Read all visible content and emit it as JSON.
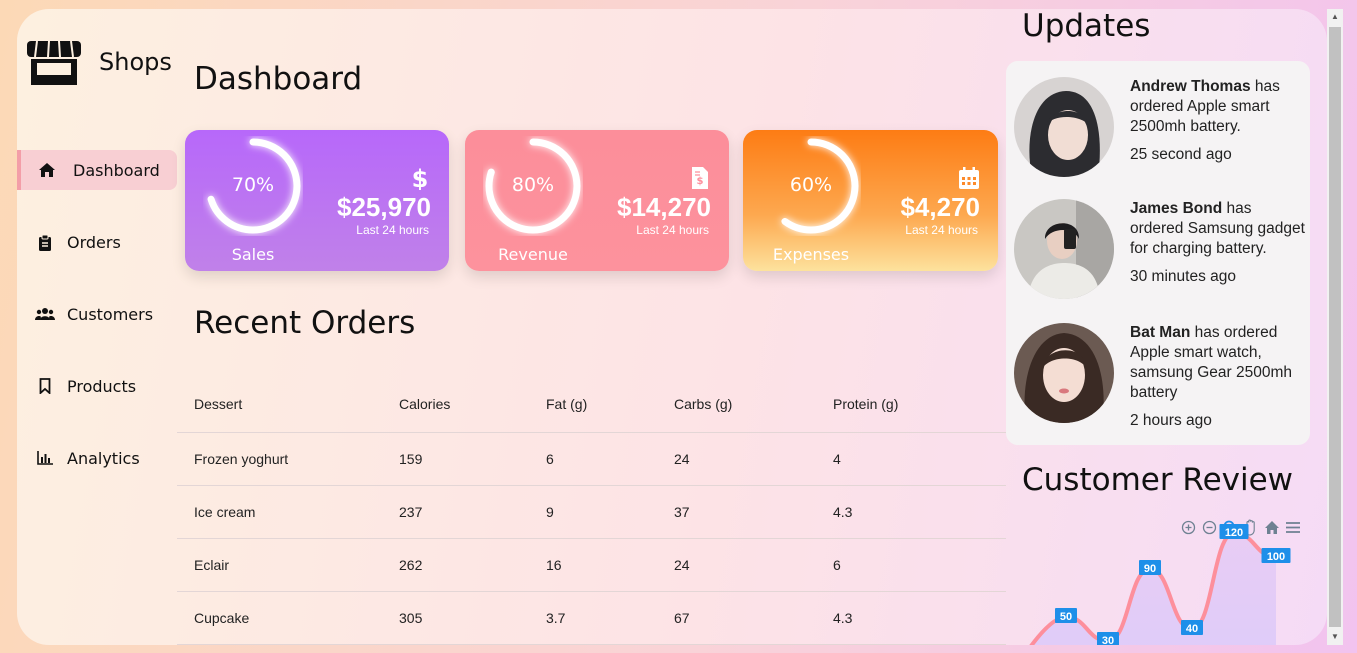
{
  "app": {
    "title": "Shops"
  },
  "sidebar": {
    "items": [
      {
        "label": "Dashboard",
        "icon": "home-icon",
        "active": true
      },
      {
        "label": "Orders",
        "icon": "clipboard-icon",
        "active": false
      },
      {
        "label": "Customers",
        "icon": "users-icon",
        "active": false
      },
      {
        "label": "Products",
        "icon": "bookmark-icon",
        "active": false
      },
      {
        "label": "Analytics",
        "icon": "bar-chart-icon",
        "active": false
      }
    ]
  },
  "main": {
    "title": "Dashboard",
    "cards": [
      {
        "label": "Sales",
        "percent": "70%",
        "progress": 70,
        "amount": "$25,970",
        "period": "Last 24 hours",
        "icon": "dollar-icon"
      },
      {
        "label": "Revenue",
        "percent": "80%",
        "progress": 80,
        "amount": "$14,270",
        "period": "Last 24 hours",
        "icon": "invoice-icon"
      },
      {
        "label": "Expenses",
        "percent": "60%",
        "progress": 60,
        "amount": "$4,270",
        "period": "Last 24 hours",
        "icon": "calendar-icon"
      }
    ],
    "recent_orders": {
      "title": "Recent Orders",
      "columns": [
        "Dessert",
        "Calories",
        "Fat (g)",
        "Carbs (g)",
        "Protein (g)"
      ],
      "rows": [
        [
          "Frozen yoghurt",
          "159",
          "6",
          "24",
          "4"
        ],
        [
          "Ice cream",
          "237",
          "9",
          "37",
          "4.3"
        ],
        [
          "Eclair",
          "262",
          "16",
          "24",
          "6"
        ],
        [
          "Cupcake",
          "305",
          "3.7",
          "67",
          "4.3"
        ]
      ]
    }
  },
  "updates": {
    "title": "Updates",
    "items": [
      {
        "name": "Andrew Thomas",
        "text": "has ordered Apple smart 2500mh battery.",
        "time": "25 second ago"
      },
      {
        "name": "James Bond",
        "text": "has ordered Samsung gadget for charging battery.",
        "time": "30 minutes ago"
      },
      {
        "name": "Bat Man",
        "text": "has ordered Apple smart watch, samsung Gear 2500mh battery",
        "time": "2 hours ago"
      }
    ]
  },
  "review": {
    "title": "Customer Review",
    "toolbar": [
      "zoom-in-icon",
      "zoom-out-icon",
      "search-icon",
      "pan-hand-icon",
      "home-icon",
      "menu-icon"
    ]
  },
  "chart_data": {
    "type": "area",
    "values": [
      50,
      30,
      90,
      40,
      120,
      100
    ],
    "data_labels": [
      "50",
      "30",
      "90",
      "40",
      "120",
      "100"
    ],
    "line_color": "#fd8f9c",
    "label_color": "#1e8fe9"
  }
}
